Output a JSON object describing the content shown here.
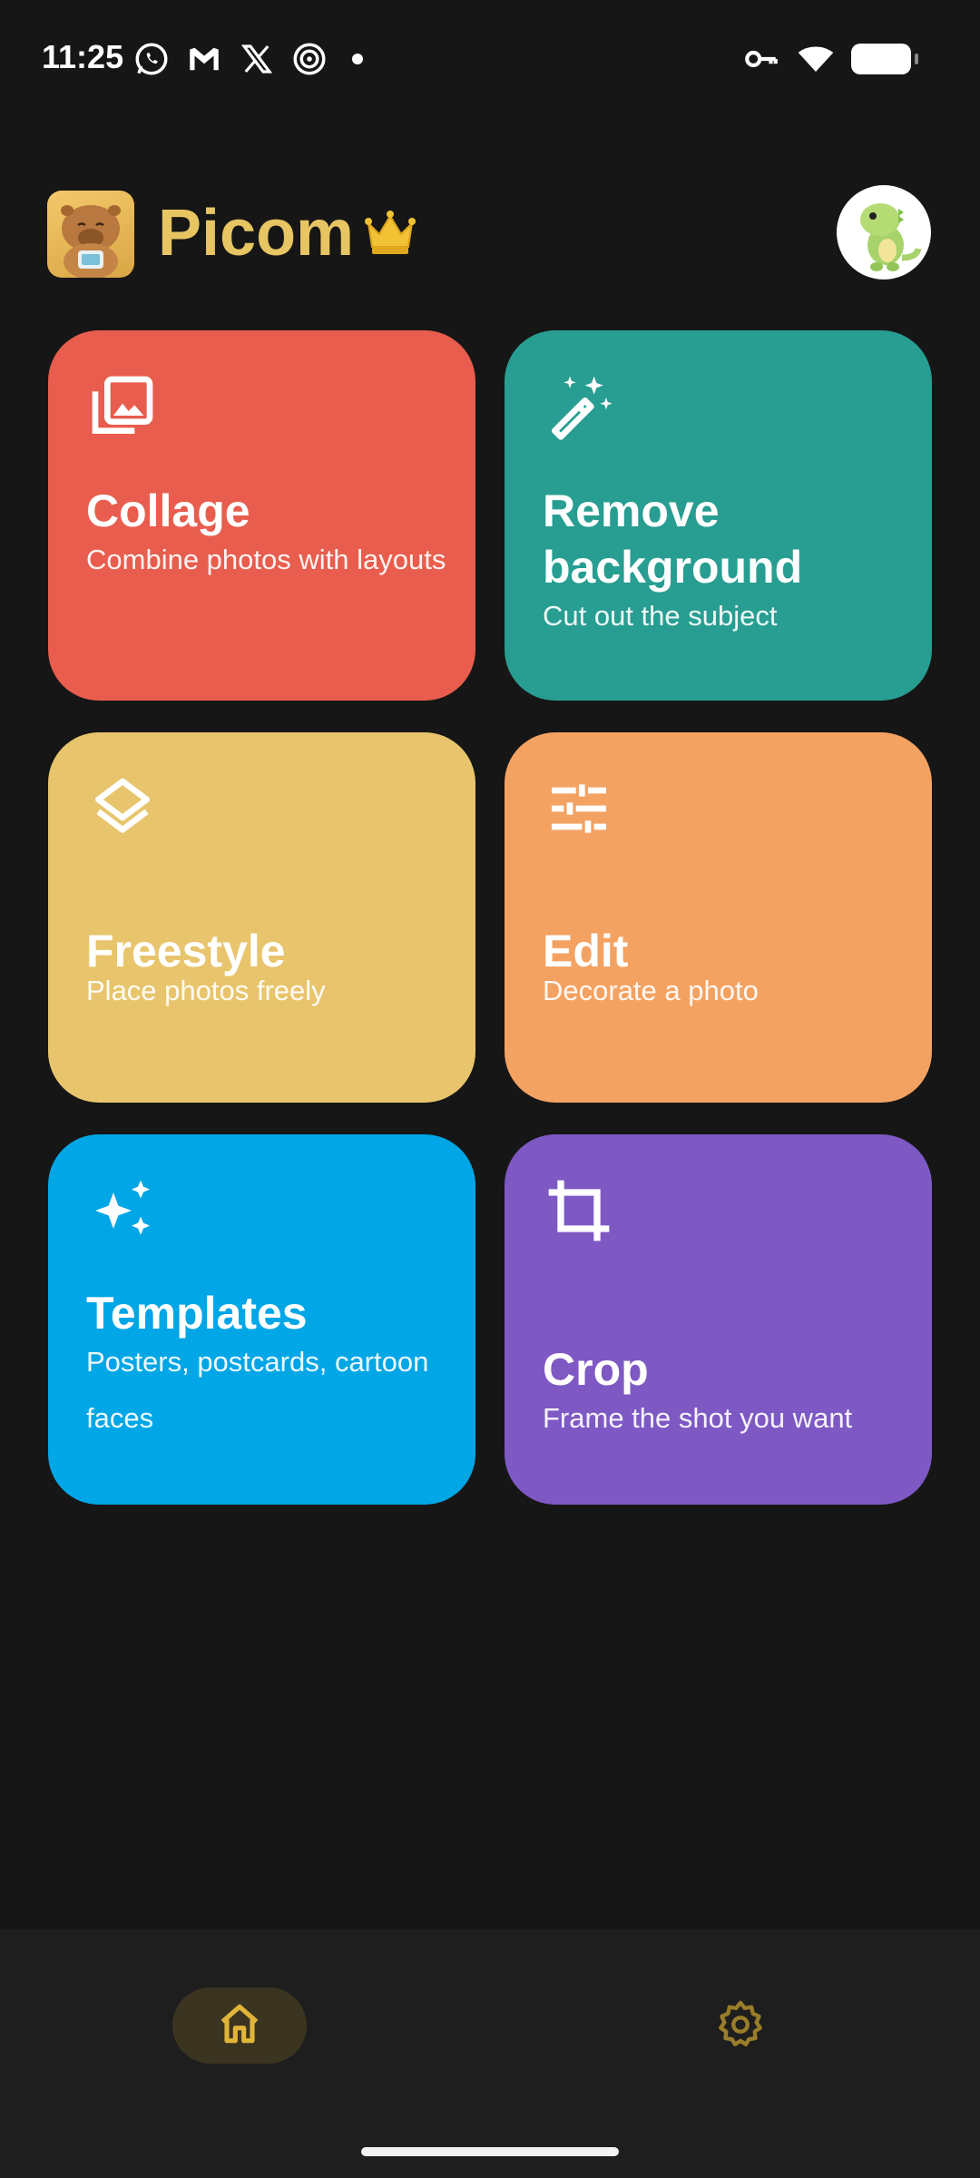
{
  "status_bar": {
    "time": "11:25",
    "left_icons": [
      "whatsapp-icon",
      "gmail-icon",
      "x-icon",
      "threads-icon",
      "more-dot"
    ],
    "right_icons": [
      "vpn-key-icon",
      "wifi-icon",
      "battery-icon"
    ]
  },
  "header": {
    "app_name": "Picom",
    "logo": "capybara-logo",
    "badge": "crown-icon",
    "avatar": "dinosaur-avatar"
  },
  "cards": [
    {
      "title": "Collage",
      "subtitle": "Combine photos with layouts",
      "icon": "photo-library-icon",
      "color": "#E85D4D"
    },
    {
      "title": "Remove background",
      "subtitle": "Cut out the subject",
      "icon": "magic-wand-icon",
      "color": "#279E91"
    },
    {
      "title": "Freestyle",
      "subtitle": "Place photos freely",
      "icon": "layers-icon",
      "color": "#E8C56C"
    },
    {
      "title": "Edit",
      "subtitle": "Decorate a photo",
      "icon": "tune-icon",
      "color": "#F4A262"
    },
    {
      "title": "Templates",
      "subtitle": "Posters, postcards, cartoon faces",
      "icon": "sparkles-icon",
      "color": "#00A6E6"
    },
    {
      "title": "Crop",
      "subtitle": "Frame the shot you want",
      "icon": "crop-icon",
      "color": "#7E59C4"
    }
  ],
  "bottom_nav": {
    "items": [
      {
        "icon": "home-icon",
        "selected": true
      },
      {
        "icon": "gear-icon",
        "selected": false
      }
    ],
    "accent": "#E0B53A"
  }
}
